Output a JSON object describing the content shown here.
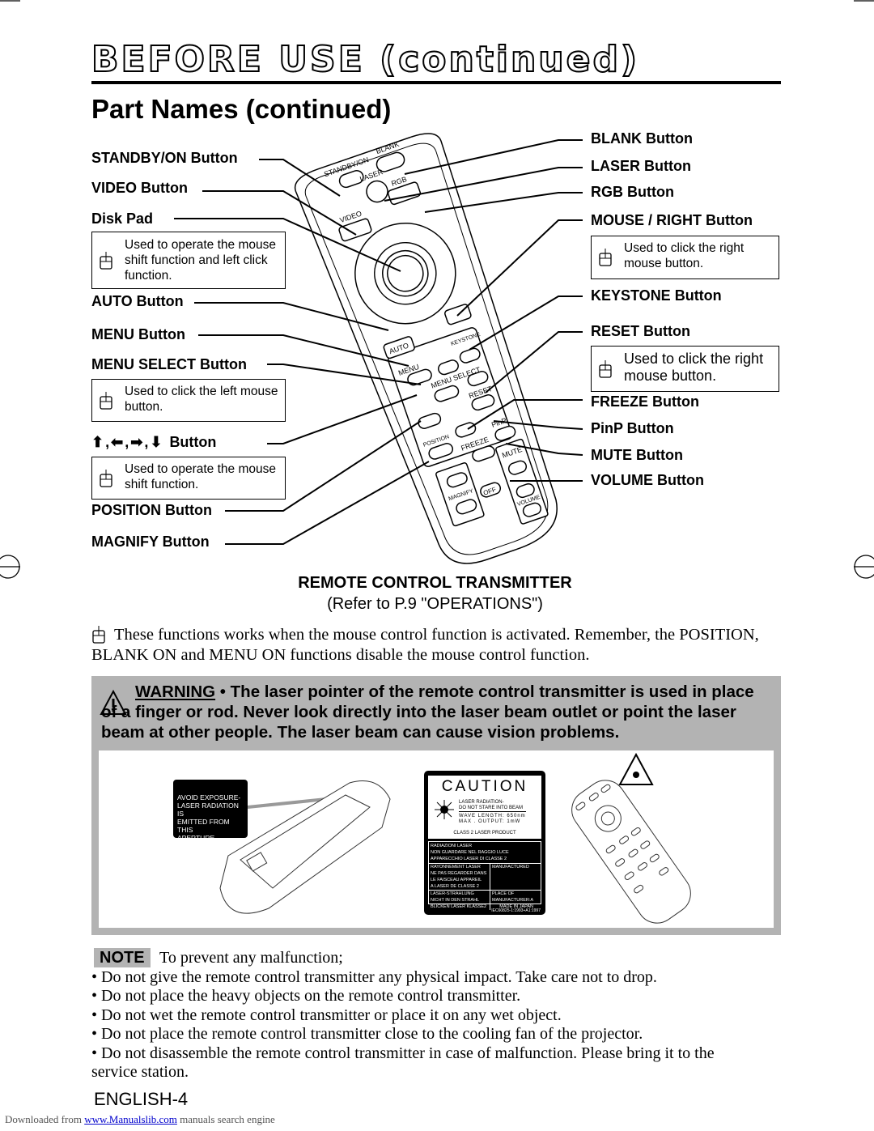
{
  "header": {
    "title": "BEFORE USE (continued)",
    "subtitle": "Part Names (continued)"
  },
  "left_labels": {
    "standby": "STANDBY/ON Button",
    "video": "VIDEO Button",
    "disk": "Disk Pad",
    "disk_note": "Used to operate the mouse shift function and left click function.",
    "auto": "AUTO Button",
    "menu": "MENU Button",
    "menu_select": "MENU SELECT Button",
    "menu_select_note": "Used to click the left mouse button.",
    "arrows": "Button",
    "arrows_note": "Used to operate the mouse shift function.",
    "position": "POSITION Button",
    "magnify": "MAGNIFY Button"
  },
  "right_labels": {
    "blank": "BLANK Button",
    "laser": "LASER Button",
    "rgb": "RGB Button",
    "mouse_right": "MOUSE / RIGHT Button",
    "mouse_right_note": "Used to click the right mouse button.",
    "keystone": "KEYSTONE Button",
    "reset": "RESET Button",
    "reset_note": "Used to click the right mouse button.",
    "freeze": "FREEZE Button",
    "pinp": "PinP Button",
    "mute": "MUTE Button",
    "volume": "VOLUME Button"
  },
  "remote_labels": {
    "standby": "STANDBY/ON",
    "laser": "LASER",
    "blank": "BLANK",
    "rgb": "RGB",
    "video": "VIDEO",
    "auto": "AUTO",
    "keystone": "KEYSTONE",
    "menu": "MENU",
    "menu_select": "MENU SELECT",
    "reset": "RESET",
    "position": "POSITION",
    "freeze": "FREEZE",
    "pinp": "PinP",
    "mute": "MUTE",
    "magnify": "MAGNIFY",
    "off": "OFF",
    "volume": "VOLUME"
  },
  "caption": {
    "title": "REMOTE CONTROL TRANSMITTER",
    "ref": "(Refer to P.9 \"OPERATIONS\")"
  },
  "mouse_note": "These functions works when the mouse control function is activated. Remember, the POSITION, BLANK ON and MENU ON functions disable the mouse control function.",
  "warning": {
    "label": "WARNING",
    "text": " • The laser pointer of the remote control transmitter is used in place of a finger or rod. Never look directly into the laser beam outlet or point the laser beam at other people. The laser beam can cause vision problems."
  },
  "avoid_label": [
    "AVOID EXPOSURE-",
    "LASER RADIATION IS",
    "EMITTED FROM THIS",
    "APERTURE"
  ],
  "caution_label": {
    "title": "CAUTION",
    "lines": [
      "LASER RADIATION-",
      "DO NOT STARE INTO BEAM",
      "WAVE LENGTH: 650nm",
      "MAX . OUTPUT: 1mW",
      "CLASS 2 LASER PRODUCT"
    ],
    "it": [
      "RADIAZIONI LASER",
      "NON GUARDARE NEL RAGGIO LUCE",
      "APPARECCHIO LASER DI CLASSE 2"
    ],
    "fr": [
      "RAYONNEMENT LASER",
      "NE PAS REGARDER DANS",
      "LE FAISCEAU APPAREIL",
      "A LASER DE CLASSE 2"
    ],
    "de": [
      "LASER-STRAHLUNG",
      "NICHT IN DEN STRAHL",
      "BLICKEN LASER KLASSE2"
    ],
    "mfd": "MANUFACTURED",
    "place": [
      "PLACE OF",
      "MANUFACTURER:A",
      "MADE IN JAPAN"
    ],
    "std": "IEC60825-1:1993+A1:1997"
  },
  "note": {
    "label": "NOTE",
    "intro": "To prevent any malfunction;",
    "items": [
      "• Do not give the remote control transmitter any physical impact. Take care not to drop.",
      "• Do not place the heavy objects on the remote control transmitter.",
      "• Do not wet the remote control transmitter or place it on any wet object.",
      "• Do not place the remote control transmitter close to the cooling fan of the projector.",
      "• Do not disassemble the remote control transmitter in case of malfunction. Please bring it to the",
      "service station."
    ]
  },
  "page_number": "ENGLISH-4",
  "footer": {
    "prefix": "Downloaded from ",
    "link": "www.Manualslib.com",
    "suffix": " manuals search engine"
  }
}
